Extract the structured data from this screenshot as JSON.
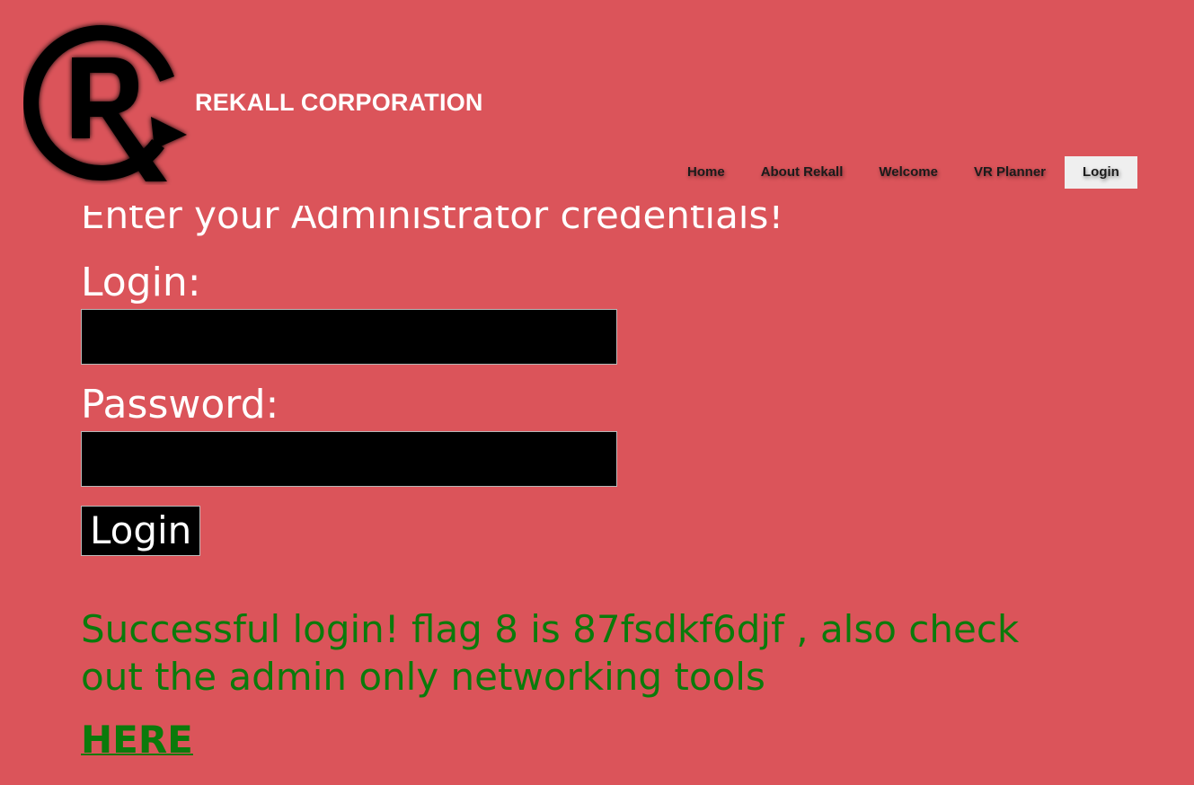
{
  "header": {
    "brand_name": "REKALL CORPORATION",
    "logo_icon": "rekall-r-logo-icon"
  },
  "nav": {
    "items": [
      {
        "label": "Home"
      },
      {
        "label": "About Rekall"
      },
      {
        "label": "Welcome"
      },
      {
        "label": "VR Planner"
      },
      {
        "label": "Login"
      }
    ],
    "active": "Login"
  },
  "form": {
    "heading": "Enter your Administrator credentials!",
    "login_label": "Login:",
    "login_value": "",
    "password_label": "Password:",
    "password_value": "",
    "submit_label": "Login"
  },
  "result": {
    "message": "Successful login! flag 8 is 87fsdkf6djf , also check out the admin only networking tools",
    "link_label": "HERE"
  },
  "colors": {
    "background": "#db545a",
    "success_text": "#0b7a0b",
    "input_background": "#000000",
    "active_nav_background": "#efefef"
  }
}
